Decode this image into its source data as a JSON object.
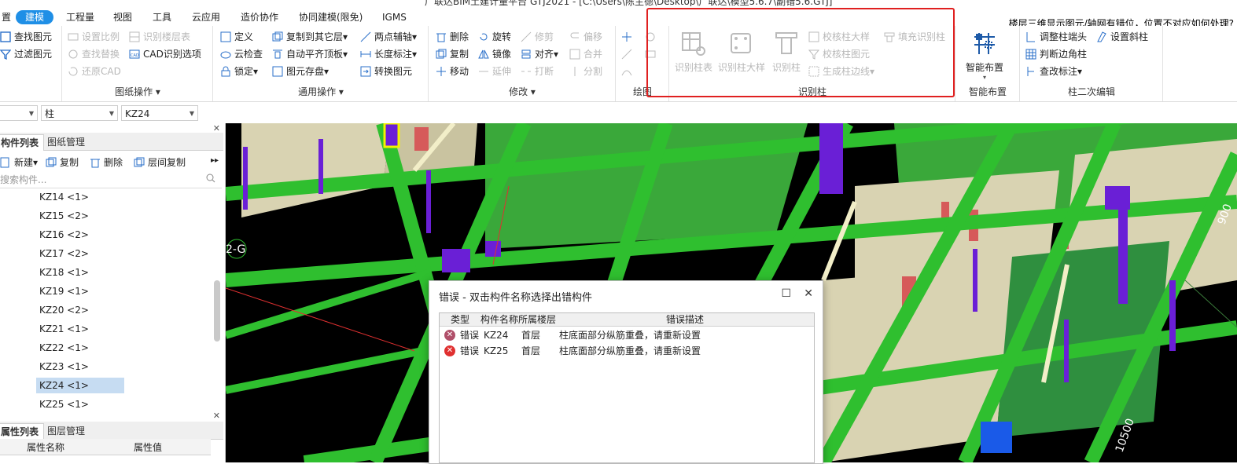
{
  "window_title": "广联达BIM土建计量平台 GTJ2021 - [C:\\Users\\陈主德\\Desktop\\广联达\\模型5.6.7\\副错5.6.GTJ]",
  "tabs": [
    "置",
    "建模",
    "工程量",
    "视图",
    "工具",
    "云应用",
    "造价协作",
    "协同建模(限免)",
    "IGMS"
  ],
  "active_tab": "建模",
  "question": "楼层三维显示图元/轴网有错位，位置不对应如何处理?",
  "ribbon": {
    "find": {
      "a": "查找图元",
      "b": "过滤图元"
    },
    "drawing_ops": {
      "label": "图纸操作",
      "items": [
        "设置比例",
        "识别楼层表",
        "查找替换",
        "CAD识别选项",
        "还原CAD"
      ]
    },
    "general_ops": {
      "label": "通用操作",
      "items": [
        "定义",
        "复制到其它层",
        "两点辅轴",
        "云检查",
        "自动平齐顶板",
        "长度标注",
        "锁定",
        "图元存盘",
        "转换图元"
      ]
    },
    "modify": {
      "label": "修改",
      "items": [
        "删除",
        "旋转",
        "修剪",
        "偏移",
        "复制",
        "镜像",
        "对齐",
        "合并",
        "移动",
        "延伸",
        "打断",
        "分割"
      ]
    },
    "draw": {
      "label": "绘图"
    },
    "recognize_col": {
      "label": "识别柱",
      "big": [
        "识别柱表",
        "识别柱大样",
        "识别柱"
      ],
      "items": [
        "校核柱大样",
        "填充识别柱",
        "校核柱图元",
        "生成柱边线"
      ]
    },
    "smart": {
      "label": "智能布置",
      "big": "智能布置"
    },
    "col_edit": {
      "label": "柱二次编辑",
      "items": [
        "调整柱端头",
        "设置斜柱",
        "判断边角柱",
        "查改标注"
      ]
    }
  },
  "selectors": {
    "floor": "",
    "type": "柱",
    "name": "KZ24"
  },
  "component_panel": {
    "tabs": [
      "构件列表",
      "图纸管理"
    ],
    "toolbar": [
      "新建",
      "复制",
      "删除",
      "层间复制"
    ],
    "search_placeholder": "搜索构件...",
    "items": [
      "KZ14 <1>",
      "KZ15 <2>",
      "KZ16 <2>",
      "KZ17 <2>",
      "KZ18 <1>",
      "KZ19 <1>",
      "KZ20 <2>",
      "KZ21 <1>",
      "KZ22 <1>",
      "KZ23 <1>",
      "KZ24 <1>",
      "KZ25 <1>"
    ],
    "selected": "KZ24 <1>"
  },
  "property_panel": {
    "tabs": [
      "属性列表",
      "图层管理"
    ],
    "headers": [
      "属性名称",
      "属性值"
    ]
  },
  "viewport": {
    "axis_label": "2-G",
    "dim_right_top": "900",
    "dim_bottom_right": "10500"
  },
  "dialog": {
    "title": "错误 - 双击构件名称选择出错构件",
    "headers": [
      "类型",
      "构件名称",
      "所属楼层",
      "错误描述"
    ],
    "rows": [
      {
        "type": "错误",
        "name": "KZ24",
        "floor": "首层",
        "desc": "柱底面部分纵筋重叠，请重新设置"
      },
      {
        "type": "错误",
        "name": "KZ25",
        "floor": "首层",
        "desc": "柱底面部分纵筋重叠，请重新设置"
      }
    ]
  },
  "colors": {
    "accent": "#1f8fe6",
    "beam": "#2fbf2f",
    "column": "#6a1fd6",
    "wall": "#d8d2b0",
    "error": "#e03030",
    "highlight_box": "#e02020"
  }
}
